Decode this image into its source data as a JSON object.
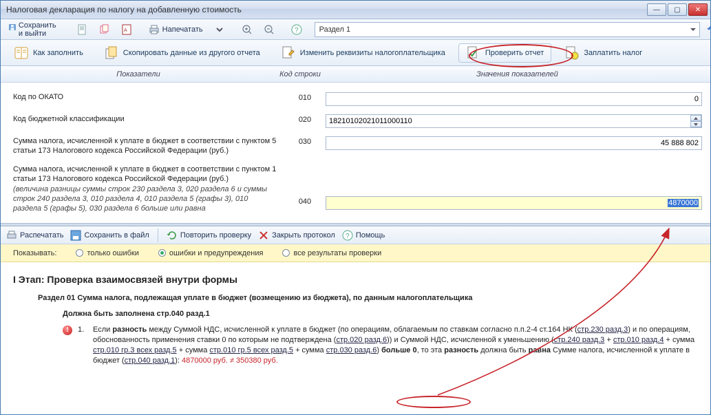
{
  "window": {
    "title": "Налоговая декларация по налогу на добавленную стоимость"
  },
  "toolbar": {
    "save_exit": "Сохранить и выйти",
    "print": "Напечатать",
    "section_value": "Раздел 1"
  },
  "cmdbar": {
    "howto": "Как заполнить",
    "copy": "Скопировать данные из другого отчета",
    "requisites": "Изменить реквизиты налогоплательщика",
    "check": "Проверить отчет",
    "pay": "Заплатить налог"
  },
  "header": {
    "indicators": "Показатели",
    "code": "Код строки",
    "values": "Значения показателей"
  },
  "rows": [
    {
      "label": "Код по ОКАТО",
      "code": "010",
      "value": "0",
      "kind": "right"
    },
    {
      "label": "Код бюджетной классификации",
      "code": "020",
      "value": "18210102021011000110",
      "kind": "leftspin"
    },
    {
      "label": "Сумма налога, исчисленной к уплате в бюджет в соответствии с пунктом 5 статьи 173 Налогового кодекса Российской Федерации (руб.)",
      "code": "030",
      "value": "45 888 802",
      "kind": "right"
    },
    {
      "label": "Сумма налога, исчисленной к уплате в бюджет в соответствии с пунктом 1 статьи 173 Налогового кодекса Российской Федерации (руб.)",
      "note": "(величина разницы суммы строк 230 раздела 3, 020 раздела 6 и суммы строк 240 раздела 3, 010 раздела 4, 010 раздела 5 (графы 3), 010 раздела 5 (графы 5), 030 раздела 6 больше или равна",
      "code": "040",
      "value": "4870000",
      "kind": "yellowsel"
    }
  ],
  "proto": {
    "print": "Распечатать",
    "save": "Сохранить в файл",
    "repeat": "Повторить проверку",
    "close": "Закрыть протокол",
    "help": "Помощь"
  },
  "filter": {
    "label": "Показывать:",
    "opt1": "только ошибки",
    "opt2": "ошибки и предупреждения",
    "opt3": "все результаты проверки"
  },
  "results": {
    "stage": "I Этап: Проверка взаимосвязей внутри формы",
    "section": "Раздел 01 Сумма налога, подлежащая уплате в бюджет (возмещению из бюджета), по данным налогоплательщика",
    "subsection": "Должна быть заполнена стр.040 разд.1",
    "item_num": "1.",
    "item_pre": "Если ",
    "bold1": "разность",
    "t1": " между Суммой НДС, исчисленной к уплате в бюджет (по операциям, облагаемым по ставкам согласно п.п.2-4 ст.164 НК (",
    "u1": "стр.230 разд.3",
    "t2": ") и по операциям, обоснованность применения ставки 0 по которым не подтверждена (",
    "u2": "стр.020 разд.6",
    "t3": ")) и Суммой НДС, исчисленной к уменьшению (",
    "u3": "стр.240 разд.3",
    "t3a": " + ",
    "u4": "стр.010 разд.4",
    "t3b": " + ",
    "u5_pre": "сумма ",
    "u5": "стр.010 гр.3 всех разд.5",
    "t3c": " + ",
    "u6_pre": "сумма ",
    "u6": "стр.010 гр.5 всех разд.5",
    "t3d": " + сумма ",
    "u7": "стр.030 разд.6",
    "t4": ") ",
    "bold2": "больше 0",
    "t5": ", то эта ",
    "bold3": "разность",
    "t6": " должна быть ",
    "bold4": "равна",
    "t7": " Сумме налога, исчисленной к уплате в бюджет (",
    "u8": "стр.040 разд.1",
    "t8": "): ",
    "mismatch": "4870000 руб. ≠ 350380 руб."
  }
}
